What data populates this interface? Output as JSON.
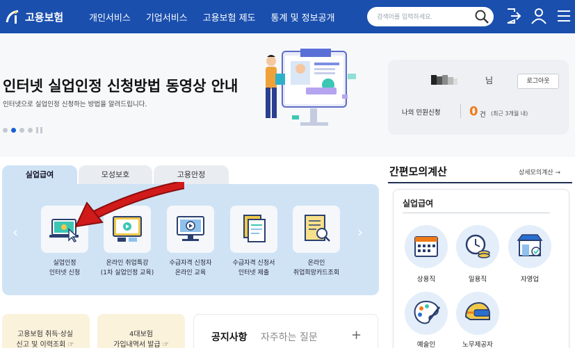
{
  "header": {
    "logo_text": "고용보험",
    "nav": [
      "개인서비스",
      "기업서비스",
      "고용보험 제도",
      "통계 및 정보공개"
    ],
    "search_placeholder": "검색어를 입력하세요."
  },
  "banner": {
    "title": "인터넷 실업인정 신청방법 동영상 안내",
    "subtitle": "인터넷으로 실업인정 신청하는 방법을 알려드립니다.",
    "slides_total": 4,
    "slide_active": 2
  },
  "login": {
    "user_suffix": "님",
    "logout_label": "로그아웃",
    "my_requests_label": "나의 민원신청",
    "my_requests_count": "0",
    "my_requests_unit": "건",
    "my_requests_range": "(최근 3개월 내)"
  },
  "tabs": [
    {
      "label": "실업급여",
      "active": true
    },
    {
      "label": "모성보호",
      "active": false
    },
    {
      "label": "고용안정",
      "active": false
    }
  ],
  "services": [
    {
      "line1": "실업인정",
      "line2": "인터넷 신청",
      "icon": "laptop-cursor-icon"
    },
    {
      "line1": "온라인 취업특강",
      "line2": "(1차 실업인정 교육)",
      "icon": "video-lecture-icon"
    },
    {
      "line1": "수급자격 신청자",
      "line2": "온라인 교육",
      "icon": "monitor-play-icon"
    },
    {
      "line1": "수급자격 신청서",
      "line2": "인터넷 제출",
      "icon": "document-stack-icon"
    },
    {
      "line1": "온라인",
      "line2": "취업희망카드조회",
      "icon": "document-search-icon"
    }
  ],
  "calc": {
    "title": "간편모의계산",
    "more": "상세모의계산 →",
    "section": "실업급여",
    "items": [
      {
        "label": "상용직",
        "icon": "calendar-icon"
      },
      {
        "label": "일용직",
        "icon": "clock-coins-icon"
      },
      {
        "label": "자영업",
        "icon": "store-icon"
      },
      {
        "label": "예술인",
        "icon": "palette-icon"
      },
      {
        "label": "노무제공자",
        "icon": "helmet-icon"
      }
    ]
  },
  "bottom_cards": [
    {
      "line1": "고용보험 취득·상실",
      "line2": "신고 및 이력조회 ☞"
    },
    {
      "line1": "4대보험",
      "line2": "가입내역서 발급 ☞"
    }
  ],
  "notice": {
    "tab1": "공지사항",
    "tab2": "자주하는 질문",
    "plus": "+"
  },
  "colors": {
    "header_bg": "#1a4fae",
    "panel_bg": "#cfe3f5",
    "accent_orange": "#f07a16",
    "arrow_red": "#d11a1a"
  }
}
